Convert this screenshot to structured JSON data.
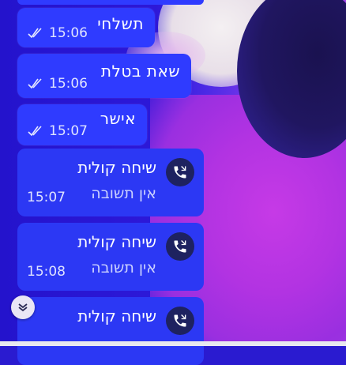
{
  "messages": [
    {
      "text": "תשלחי",
      "time": "15:06"
    },
    {
      "text": "שאת בטלת",
      "time": "15:06"
    },
    {
      "text": "אישר",
      "time": "15:07"
    }
  ],
  "calls": [
    {
      "title": "שיחה קולית",
      "status": "אין תשובה",
      "time": "15:07"
    },
    {
      "title": "שיחה קולית",
      "status": "אין תשובה",
      "time": "15:08"
    },
    {
      "title": "שיחה קולית",
      "status": "",
      "time": ""
    }
  ],
  "icons": {
    "read_receipt": "double-check-icon",
    "call": "missed-call-icon",
    "scroll": "chevron-down-icon"
  },
  "colors": {
    "bubble": "#2f3bff",
    "call_icon_bg": "#1e2260"
  }
}
